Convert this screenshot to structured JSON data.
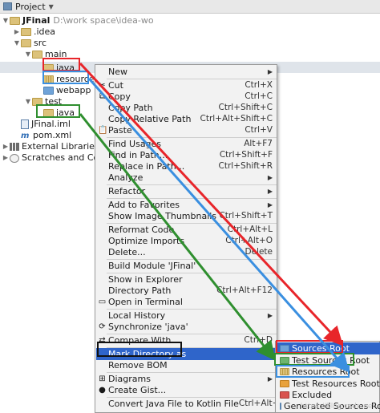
{
  "tool_window": {
    "title": "Project"
  },
  "tree": {
    "root_name": "JFinal",
    "root_path": "D:\\work space\\idea-wo",
    "idea": ".idea",
    "src": "src",
    "main": "main",
    "java": "java",
    "resources": "resources",
    "webapp": "webapp",
    "test": "test",
    "test_java": "java",
    "iml": "JFinal.iml",
    "pom": "pom.xml",
    "ext_libs": "External Libraries",
    "scratches": "Scratches and Console"
  },
  "menu": {
    "new": "New",
    "cut": "Cut",
    "cut_sc": "Ctrl+X",
    "copy": "Copy",
    "copy_sc": "Ctrl+C",
    "copy_path": "Copy Path",
    "copy_path_sc": "Ctrl+Shift+C",
    "copy_rel": "Copy Relative Path",
    "copy_rel_sc": "Ctrl+Alt+Shift+C",
    "paste": "Paste",
    "paste_sc": "Ctrl+V",
    "find_usages": "Find Usages",
    "find_usages_sc": "Alt+F7",
    "find_path": "Find in Path...",
    "find_path_sc": "Ctrl+Shift+F",
    "replace_path": "Replace in Path...",
    "replace_path_sc": "Ctrl+Shift+R",
    "analyze": "Analyze",
    "refactor": "Refactor",
    "add_fav": "Add to Favorites",
    "show_thumbs": "Show Image Thumbnails",
    "show_thumbs_sc": "Ctrl+Shift+T",
    "reformat": "Reformat Code",
    "reformat_sc": "Ctrl+Alt+L",
    "optimize": "Optimize Imports",
    "optimize_sc": "Ctrl+Alt+O",
    "delete": "Delete...",
    "delete_sc": "Delete",
    "build": "Build Module 'JFinal'",
    "show_explorer": "Show in Explorer",
    "dir_path": "Directory Path",
    "dir_path_sc": "Ctrl+Alt+F12",
    "open_terminal": "Open in Terminal",
    "local_history": "Local History",
    "sync": "Synchronize 'java'",
    "compare": "Compare With...",
    "compare_sc": "Ctrl+D",
    "mark_dir": "Mark Directory as",
    "remove_bom": "Remove BOM",
    "diagrams": "Diagrams",
    "gist": "Create Gist...",
    "convert": "Convert Java File to Kotlin File",
    "convert_sc": "Ctrl+Alt+Shift+K"
  },
  "submenu": {
    "sources_root": "Sources Root",
    "test_sources_root": "Test Sources Root",
    "resources_root": "Resources Root",
    "test_resources_root": "Test Resources Root",
    "excluded": "Excluded",
    "generated": "Generated Sources Root"
  },
  "watermark": "https://blog.csdn.net",
  "colors": {
    "selection": "#2f65ca",
    "arrow_red": "#e8252a",
    "arrow_blue": "#3a8fe0",
    "arrow_green": "#2f8f2f",
    "box_black": "#111111"
  },
  "icons": [
    "folder-icon",
    "cut-icon",
    "copy-icon",
    "paste-icon",
    "diagram-icon",
    "github-icon"
  ]
}
